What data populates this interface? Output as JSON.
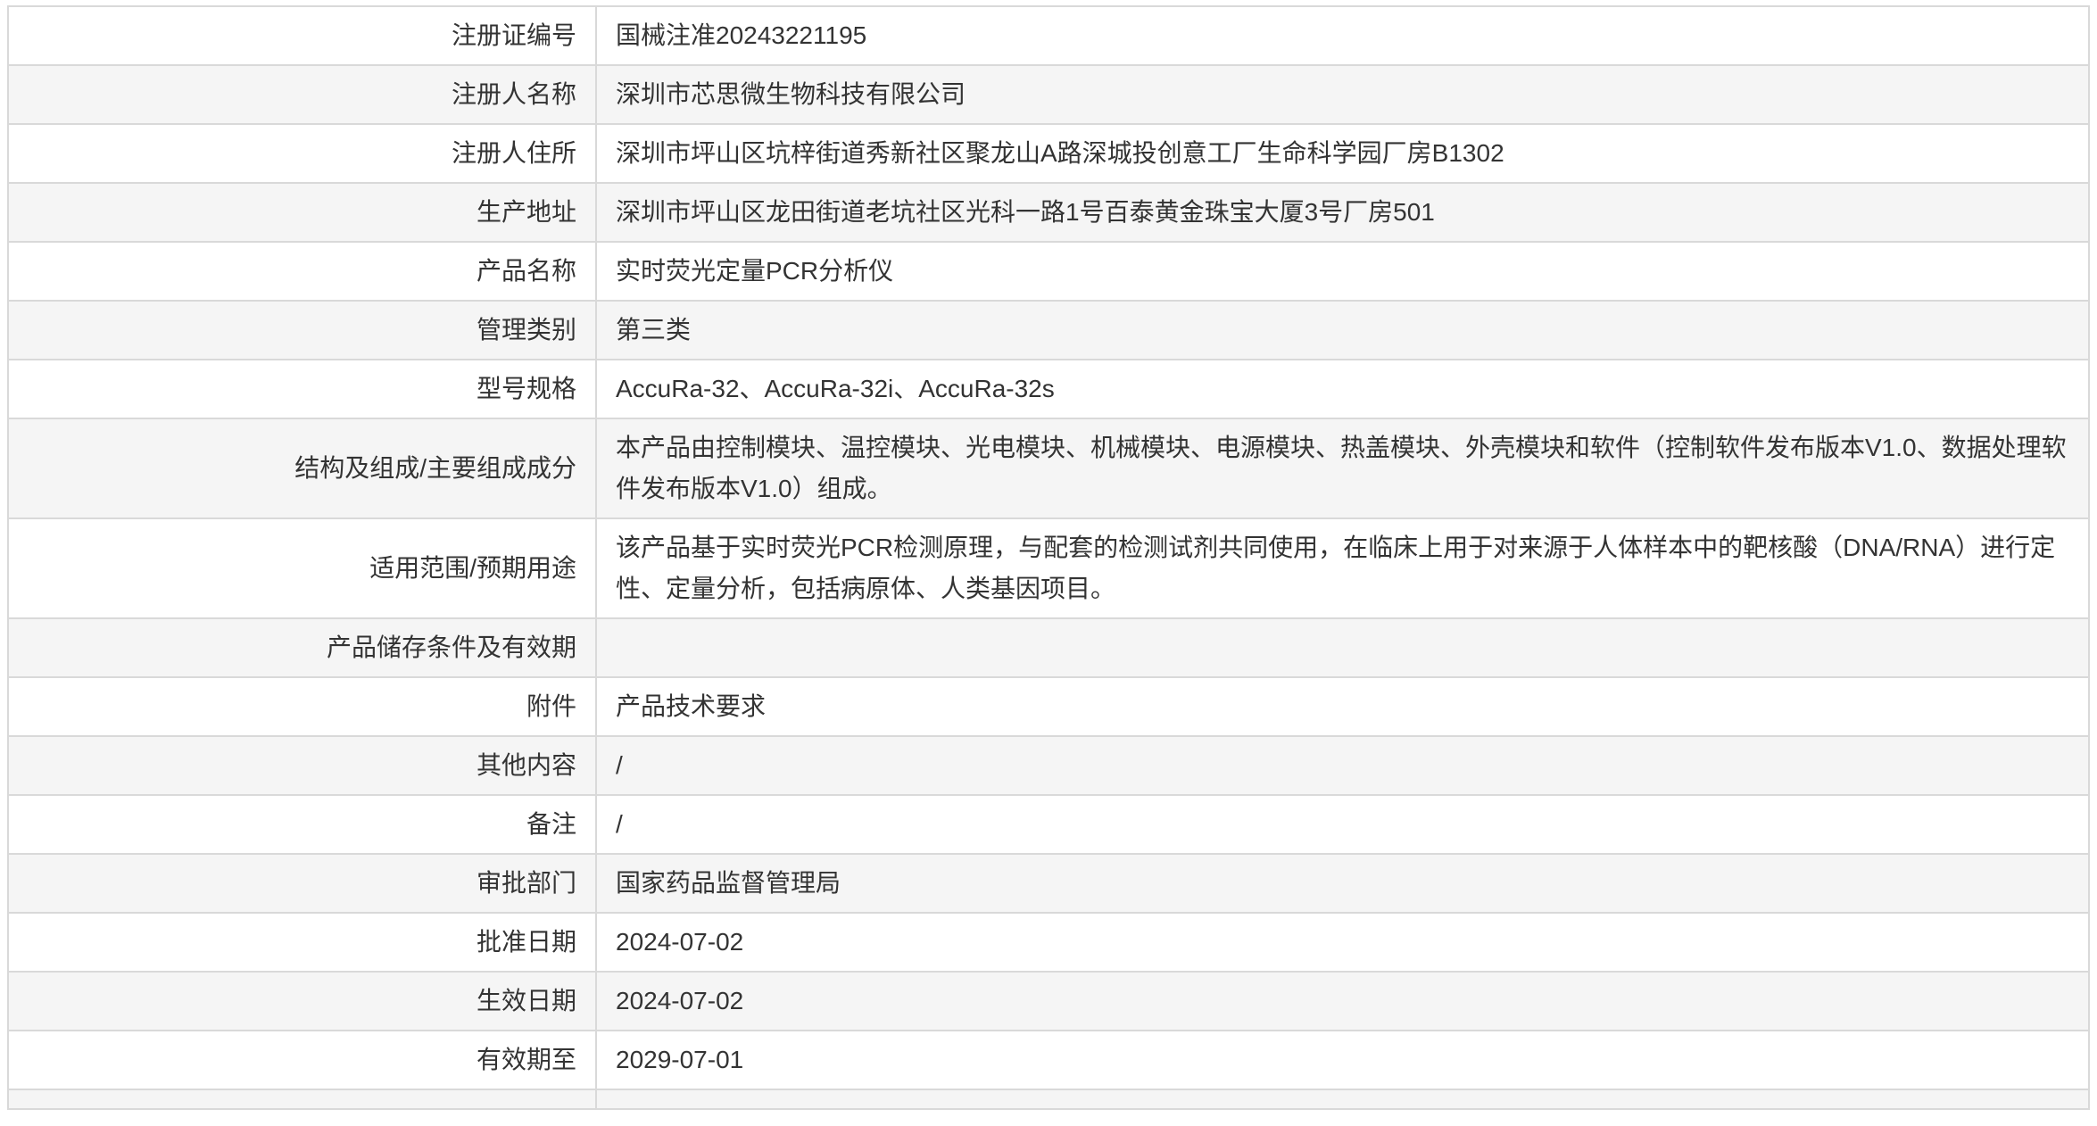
{
  "rows": [
    {
      "label": "注册证编号",
      "value": "国械注准20243221195"
    },
    {
      "label": "注册人名称",
      "value": "深圳市芯思微生物科技有限公司"
    },
    {
      "label": "注册人住所",
      "value": "深圳市坪山区坑梓街道秀新社区聚龙山A路深城投创意工厂生命科学园厂房B1302"
    },
    {
      "label": "生产地址",
      "value": "深圳市坪山区龙田街道老坑社区光科一路1号百泰黄金珠宝大厦3号厂房501"
    },
    {
      "label": "产品名称",
      "value": "实时荧光定量PCR分析仪"
    },
    {
      "label": "管理类别",
      "value": "第三类"
    },
    {
      "label": "型号规格",
      "value": "AccuRa-32、AccuRa-32i、AccuRa-32s"
    },
    {
      "label": "结构及组成/主要组成成分",
      "value": "本产品由控制模块、温控模块、光电模块、机械模块、电源模块、热盖模块、外壳模块和软件（控制软件发布版本V1.0、数据处理软件发布版本V1.0）组成。"
    },
    {
      "label": "适用范围/预期用途",
      "value": "该产品基于实时荧光PCR检测原理，与配套的检测试剂共同使用，在临床上用于对来源于人体样本中的靶核酸（DNA/RNA）进行定性、定量分析，包括病原体、人类基因项目。"
    },
    {
      "label": "产品储存条件及有效期",
      "value": ""
    },
    {
      "label": "附件",
      "value": "产品技术要求"
    },
    {
      "label": "其他内容",
      "value": "/"
    },
    {
      "label": "备注",
      "value": "/"
    },
    {
      "label": "审批部门",
      "value": "国家药品监督管理局"
    },
    {
      "label": "批准日期",
      "value": "2024-07-02"
    },
    {
      "label": "生效日期",
      "value": "2024-07-02"
    },
    {
      "label": "有效期至",
      "value": "2029-07-01"
    }
  ]
}
